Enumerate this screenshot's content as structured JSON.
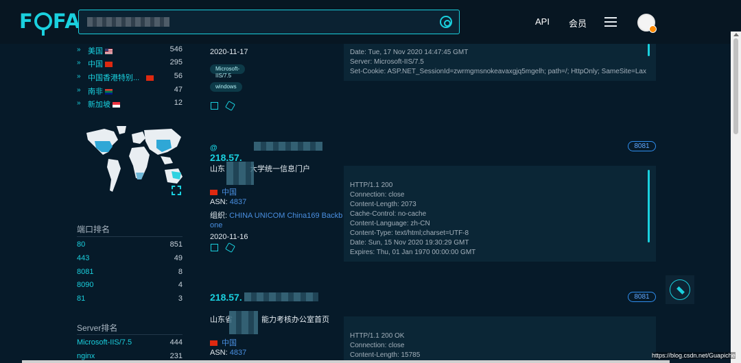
{
  "header": {
    "logo": "FOFA",
    "api_label": "API",
    "vip_label": "会员"
  },
  "left": {
    "countries": [
      {
        "name": "美国",
        "count": "546",
        "flag": "us"
      },
      {
        "name": "中国",
        "count": "295",
        "flag": "cn"
      },
      {
        "name": "中国香港特别...",
        "count": "56",
        "flag": "hk"
      },
      {
        "name": "南非",
        "count": "47",
        "flag": "za"
      },
      {
        "name": "新加坡",
        "count": "12",
        "flag": "sg"
      }
    ],
    "port_rank_title": "端口排名",
    "ports": [
      {
        "name": "80",
        "count": "851"
      },
      {
        "name": "443",
        "count": "49"
      },
      {
        "name": "8081",
        "count": "8"
      },
      {
        "name": "8090",
        "count": "4"
      },
      {
        "name": "81",
        "count": "3"
      }
    ],
    "server_rank_title": "Server排名",
    "servers": [
      {
        "name": "Microsoft-IIS/7.5",
        "count": "444"
      },
      {
        "name": "nginx",
        "count": "231"
      }
    ]
  },
  "result0": {
    "date": "2020-11-17",
    "tags": [
      "Microsoft-IIS/7.5",
      "windows"
    ],
    "panel": [
      "Date: Tue, 17 Nov 2020 14:47:45 GMT",
      "Server: Microsoft-IIS/7.5",
      "Set-Cookie: ASP.NET_SessionId=zwrmgmsnokeavaxgjq5mgelh; path=/; HttpOnly; SameSite=Lax"
    ]
  },
  "result1": {
    "ip_prefix": "218.57.",
    "port": "8081",
    "title_left": "山东",
    "title_right": "大学统一信息门户",
    "country": "中国",
    "asn_label": "ASN:",
    "asn_value": "4837",
    "org_label": "组织:",
    "org_value": "CHINA UNICOM China169 Backbone",
    "date": "2020-11-16",
    "panel": [
      "HTTP/1.1 200",
      "Connection: close",
      "Content-Length: 2073",
      "Cache-Control: no-cache",
      "Content-Language: zh-CN",
      "Content-Type: text/html;charset=UTF-8",
      "Date: Sun, 15 Nov 2020 19:30:29 GMT",
      "Expires: Thu, 01 Jan 1970 00:00:00 GMT"
    ]
  },
  "result2": {
    "ip_prefix": "218.57.",
    "port": "8081",
    "title_left": "山东省",
    "title_right": "能力考核办公室首页",
    "country": "中国",
    "asn_label": "ASN:",
    "asn_value": "4837",
    "panel": [
      "HTTP/1.1 200 OK",
      "Connection: close",
      "Content-Length: 15785"
    ]
  },
  "watermark": "https://blog.csdn.net/Guapiche"
}
